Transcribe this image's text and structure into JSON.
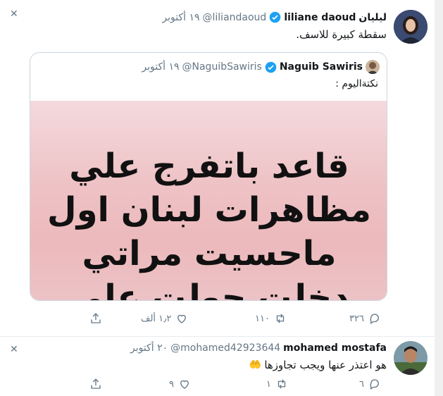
{
  "tweets": [
    {
      "name_ar": "ليليان",
      "name": "liliane daoud",
      "handle": "@liliandaoud",
      "date": "١٩ أكتوبر",
      "text": "سقطة كبيرة للاسف.",
      "quote": {
        "name": "Naguib Sawiris",
        "handle": "@NaguibSawiris",
        "date": "١٩ أكتوبر",
        "text": "نكتةاليوم :",
        "image_text": [
          "قاعد باتفرج علي",
          "مظاهرات لبنان اول",
          "ماحسيت مراتي",
          "دخلت حولت علي"
        ]
      },
      "actions": {
        "replies": "٣٢٦",
        "retweets": "١١٠",
        "likes": "١٫٢ ألف"
      }
    },
    {
      "name": "mohamed mostafa",
      "handle": "@mohamed42923644",
      "date": "٢٠ أكتوبر",
      "text": "هو اعتذر عنها ويجب تجاوزها",
      "emoji": "🤲",
      "actions": {
        "replies": "٦",
        "retweets": "١",
        "likes": "٩"
      }
    }
  ],
  "icons": [
    "close-icon",
    "verified-icon",
    "reply-icon",
    "retweet-icon",
    "like-icon",
    "share-icon"
  ],
  "colors": {
    "verified": "#1da1f2",
    "muted": "#657786",
    "text": "#14171a",
    "border": "#e6ecf0"
  }
}
